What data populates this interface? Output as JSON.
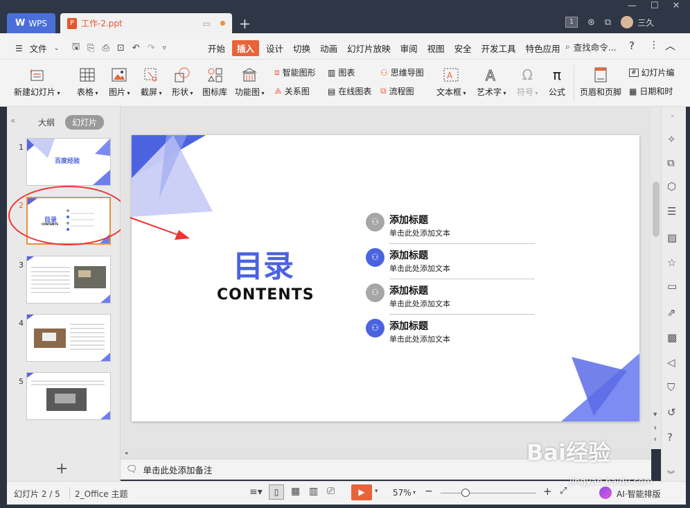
{
  "titlebar": {
    "wps_label": "WPS",
    "doc_name": "工作-2.ppt",
    "user_name": "三久",
    "page_badge": "1"
  },
  "menubar": {
    "file": "文件",
    "items": [
      "开始",
      "插入",
      "设计",
      "切换",
      "动画",
      "幻灯片放映",
      "审阅",
      "视图",
      "安全",
      "开发工具",
      "特色应用"
    ],
    "active": "插入",
    "search": "查找命令...",
    "help": "?"
  },
  "ribbon": {
    "new_slide": "新建幻灯片",
    "table": "表格",
    "picture": "图片",
    "screenshot": "截屏",
    "shape": "形状",
    "icon_lib": "图标库",
    "func_chart": "功能图",
    "smart_shape": "智能图形",
    "chart": "图表",
    "relation": "关系图",
    "online_chart": "在线图表",
    "mindmap": "思维导图",
    "flowchart": "流程图",
    "textbox": "文本框",
    "wordart": "艺术字",
    "symbol": "符号",
    "formula": "公式",
    "header_footer": "页眉和页脚",
    "slide_num": "幻灯片编",
    "datetime": "日期和时"
  },
  "leftpanel": {
    "tab_outline": "大纲",
    "tab_slides": "幻灯片",
    "thumb1_title": "百度经验",
    "thumb2_title": "目录",
    "thumb2_sub": "CONTENTS"
  },
  "slide": {
    "title": "目录",
    "subtitle": "CONTENTS",
    "items": [
      {
        "heading": "添加标题",
        "body": "单击此处添加文本"
      },
      {
        "heading": "添加标题",
        "body": "单击此处添加文本"
      },
      {
        "heading": "添加标题",
        "body": "单击此处添加文本"
      },
      {
        "heading": "添加标题",
        "body": "单击此处添加文本"
      }
    ]
  },
  "notes": {
    "placeholder": "单击此处添加备注"
  },
  "status": {
    "slide_counter": "幻灯片 2 / 5",
    "theme": "2_Office 主题",
    "zoom": "57%",
    "ai": "AI·智能排版"
  },
  "watermark": {
    "site": "Bai经验",
    "url": "jingyan.baidu.com"
  },
  "colors": {
    "accent": "#e8633a",
    "slide_blue": "#4b63e0",
    "wps_blue": "#4a6fd8"
  }
}
